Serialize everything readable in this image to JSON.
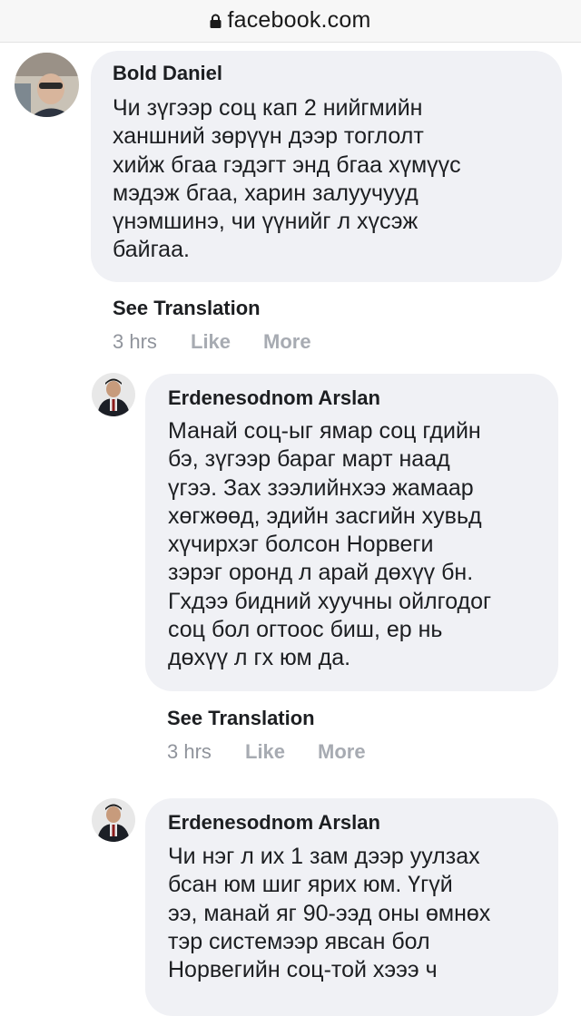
{
  "browser": {
    "url": "facebook.com",
    "lock_icon": "lock-icon"
  },
  "comments": [
    {
      "author": "Bold Daniel",
      "text": "Чи зүгээр соц кап 2 нийгмийн\nханшний зөрүүн дээр тоглолт\nхийж бгаа гэдэгт энд бгаа хүмүүс\nмэдэж бгаа, харин залуучууд\nүнэмшинэ, чи үүнийг л хүсэж\nбайгаа.",
      "see_translation": "See Translation",
      "time": "3 hrs",
      "like": "Like",
      "more": "More"
    },
    {
      "author": "Erdenesodnom Arslan",
      "text": "Манай соц-ыг ямар соц гдийн\nбэ, зүгээр бараг март наад\nүгээ. Зах зээлийнхээ жамаар\nхөгжөөд, эдийн засгийн хувьд\nхүчирхэг болсон Норвеги\nзэрэг оронд л арай дөхүү бн.\nГхдээ бидний хуучны ойлгодог\nсоц бол огтоос биш, ер нь\nдөхүү л гх юм да.",
      "see_translation": "See Translation",
      "time": "3 hrs",
      "like": "Like",
      "more": "More"
    },
    {
      "author": "Erdenesodnom Arslan",
      "text": "Чи нэг л их 1 зам дээр уулзах\nбсан юм шиг ярих юм. Үгүй\nээ, манай яг 90-ээд оны өмнөх\nтэр системээр явсан бол\nНорвегийн соц-той хэээ ч"
    }
  ]
}
